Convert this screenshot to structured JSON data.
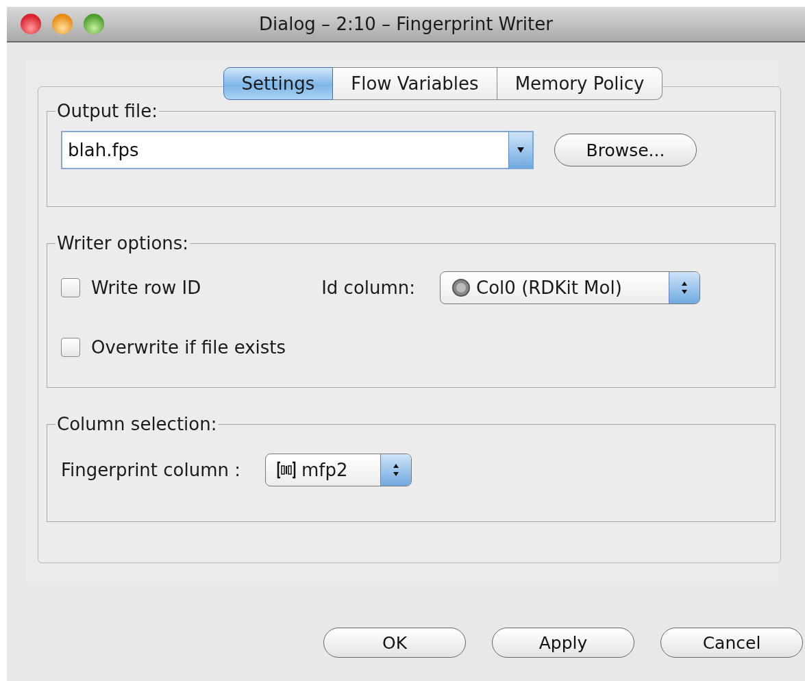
{
  "window": {
    "title": "Dialog – 2:10 – Fingerprint Writer"
  },
  "tabs": [
    {
      "label": "Settings",
      "selected": true
    },
    {
      "label": "Flow Variables",
      "selected": false
    },
    {
      "label": "Memory Policy",
      "selected": false
    }
  ],
  "output_file": {
    "legend": "Output file:",
    "value": "blah.fps",
    "browse": "Browse..."
  },
  "writer_options": {
    "legend": "Writer options:",
    "write_row_id": {
      "label": "Write row ID",
      "checked": false
    },
    "id_column": {
      "label": "Id column:",
      "value": "Col0 (RDKit Mol)"
    },
    "overwrite": {
      "label": "Overwrite if file exists",
      "checked": false
    }
  },
  "column_selection": {
    "legend": "Column selection:",
    "label": "Fingerprint column :",
    "value": "mfp2"
  },
  "buttons": [
    "OK",
    "Apply",
    "Cancel"
  ]
}
